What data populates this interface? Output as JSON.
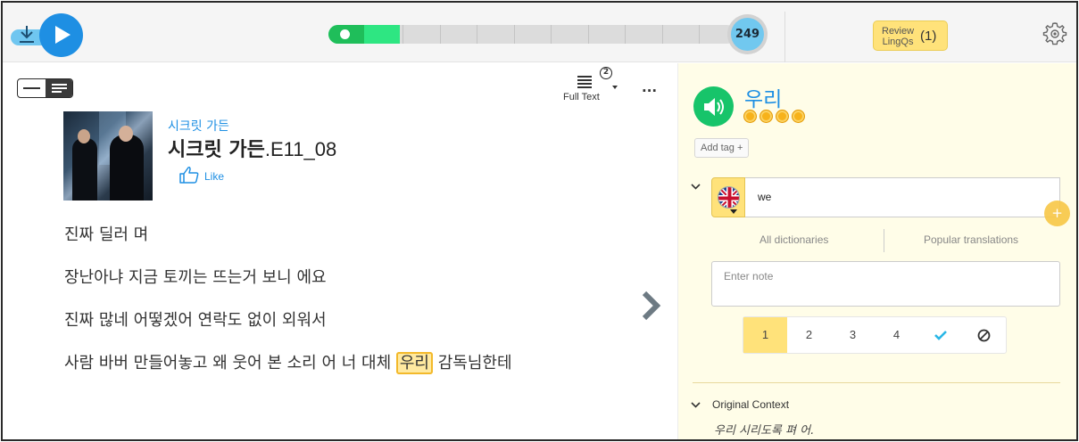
{
  "player": {
    "download_icon": "download-icon",
    "play_icon": "play-icon",
    "progress_fraction": 0.176,
    "segments": 11,
    "lingq_count": "249"
  },
  "header": {
    "review_label": "Review LingQs",
    "review_count": "(1)",
    "settings_icon": "gear-icon"
  },
  "reader": {
    "view_mode_label": "Full Text",
    "view_mode_badge": "2",
    "more_icon": "...",
    "course_title": "시크릿 가든",
    "lesson_title_main": "시크릿 가든",
    "lesson_title_suffix": ".E11_08",
    "like_label": "Like",
    "lines": [
      "진짜 딜러 며",
      "장난아냐 지금 토끼는 뜨는거 보니 에요",
      "진짜 많네 어떻겠어 연락도 없이 외워서"
    ],
    "last_line_before": "사람 바버 만들어놓고 왜 웃어 본 소리 어 너 대체 ",
    "last_line_highlight": "우리",
    "last_line_after": " 감독님한테"
  },
  "sidebar": {
    "term": "우리",
    "stars": 4,
    "add_tag_label": "Add tag +",
    "meaning": "we",
    "add_meaning_icon": "+",
    "all_dictionaries_label": "All dictionaries",
    "popular_translations_label": "Popular translations",
    "note_placeholder": "Enter note",
    "status_options": [
      "1",
      "2",
      "3",
      "4"
    ],
    "status_selected": "1",
    "known_icon": "check-icon",
    "ignore_icon": "ignore-icon",
    "original_context_label": "Original Context",
    "original_context_text": "우리 시리도록 펴 어."
  },
  "colors": {
    "accent_blue": "#1e8fe3",
    "progress_green": "#2ee682",
    "speaker_green": "#17c46a",
    "lingq_yellow": "#ffe27a",
    "sidebar_bg": "#fffde8"
  }
}
